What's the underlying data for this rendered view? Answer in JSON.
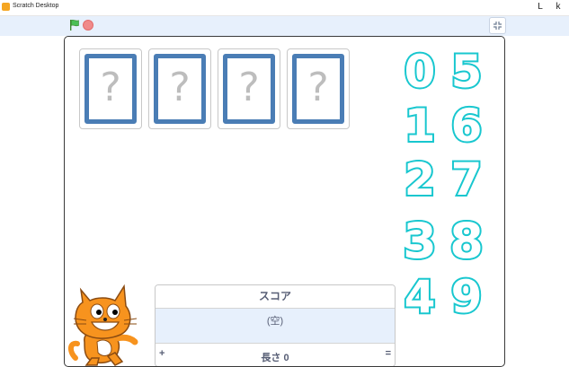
{
  "window": {
    "title": "Scratch Desktop",
    "minimize_glyph": "L",
    "maximize_glyph": "k"
  },
  "toolbar": {
    "green_flag": "green-flag-icon",
    "stop": "stop-icon",
    "fullscreen": "exit-fullscreen-icon"
  },
  "stage": {
    "cards": [
      {
        "symbol": "?"
      },
      {
        "symbol": "?"
      },
      {
        "symbol": "?"
      },
      {
        "symbol": "?"
      }
    ],
    "digits": [
      "0",
      "1",
      "2",
      "3",
      "4",
      "5",
      "6",
      "7",
      "8",
      "9"
    ],
    "digit_color": "#18c7cf",
    "card_border_color": "#4a7db5"
  },
  "list_monitor": {
    "title": "スコア",
    "empty_text": "(空)",
    "add_label": "+",
    "length_text": "長さ 0",
    "resize_label": "="
  }
}
